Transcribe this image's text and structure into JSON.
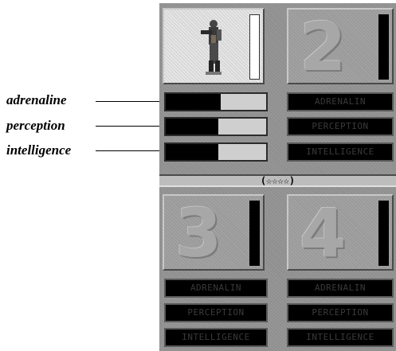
{
  "callouts": {
    "adrenaline": "adrenaline",
    "perception": "perception",
    "intelligence": "intelligence"
  },
  "divider_label": "(☆☆☆☆)",
  "slots": [
    {
      "number": "",
      "active": true,
      "stats": {
        "adrenaline": 0.55,
        "perception": 0.52,
        "intelligence": 0.52
      }
    },
    {
      "number": "2",
      "active": false,
      "stats": {
        "adrenalin": "ADRENALIN",
        "perception": "PERCEPTION",
        "intelligence": "INTELLIGENCE"
      }
    },
    {
      "number": "3",
      "active": false,
      "stats": {
        "adrenalin": "ADRENALIN",
        "perception": "PERCEPTION",
        "intelligence": "INTELLIGENCE"
      }
    },
    {
      "number": "4",
      "active": false,
      "stats": {
        "adrenalin": "ADRENALIN",
        "perception": "PERCEPTION",
        "intelligence": "INTELLIGENCE"
      }
    }
  ],
  "colors": {
    "panel": "#8f8f8f",
    "stat_empty": "#000000",
    "meter_bg": "#cfcfcf"
  }
}
